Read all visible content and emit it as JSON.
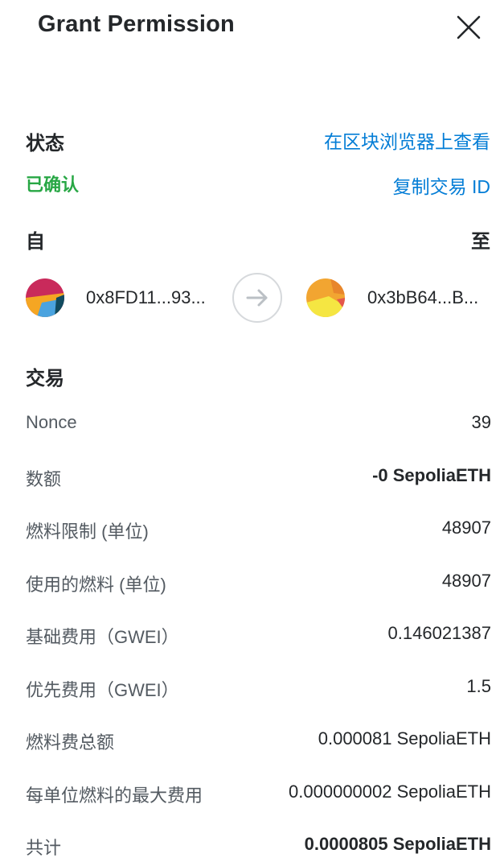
{
  "header": {
    "title": "Grant Permission"
  },
  "status": {
    "label": "状态",
    "value": "已确认",
    "value_color": "#28a745",
    "view_on_explorer": "在区块浏览器上查看",
    "copy_tx_id": "复制交易 ID"
  },
  "parties": {
    "from_label": "自",
    "to_label": "至",
    "from_address": "0x8FD11...93...",
    "to_address": "0x3bB64...B..."
  },
  "transaction": {
    "label": "交易",
    "rows": [
      {
        "label": "Nonce",
        "value": "39"
      },
      {
        "label": "数额",
        "value": "-0 SepoliaETH"
      },
      {
        "label": "燃料限制 (单位)",
        "value": "48907"
      },
      {
        "label": "使用的燃料 (单位)",
        "value": "48907"
      },
      {
        "label": "基础费用（GWEI）",
        "value": "0.146021387"
      },
      {
        "label": "优先费用（GWEI）",
        "value": "1.5"
      },
      {
        "label": "燃料费总额",
        "value": "0.000081 SepoliaETH"
      },
      {
        "label": "每单位燃料的最大费用",
        "value": "0.000000002 SepoliaETH"
      },
      {
        "label": "共计",
        "value": "0.0000805 SepoliaETH"
      }
    ]
  },
  "colors": {
    "accent_link": "#037dd6",
    "text": "#24272a",
    "muted": "#535a61"
  }
}
